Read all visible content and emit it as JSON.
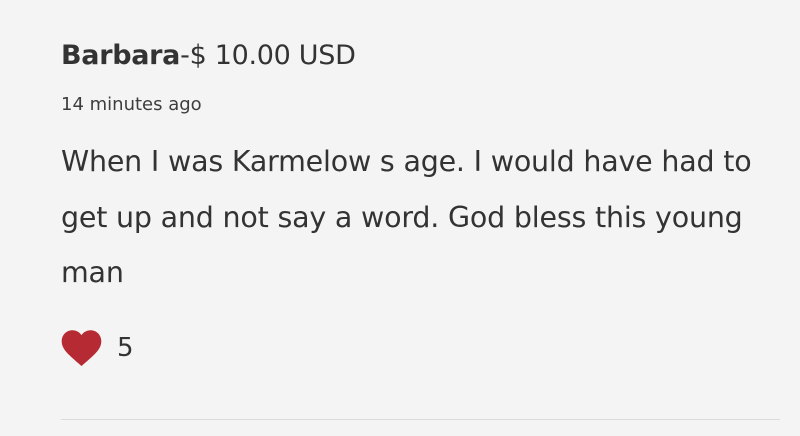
{
  "donation": {
    "donor_name": "Barbara",
    "separator": "-",
    "amount": "$ 10.00 USD",
    "timestamp": "14 minutes ago",
    "message": "When I was Karmelow s age. I would have had to get up and not say a word. God bless this young man",
    "likes": {
      "icon": "heart-icon",
      "count": "5",
      "color": "#b62a33"
    }
  }
}
